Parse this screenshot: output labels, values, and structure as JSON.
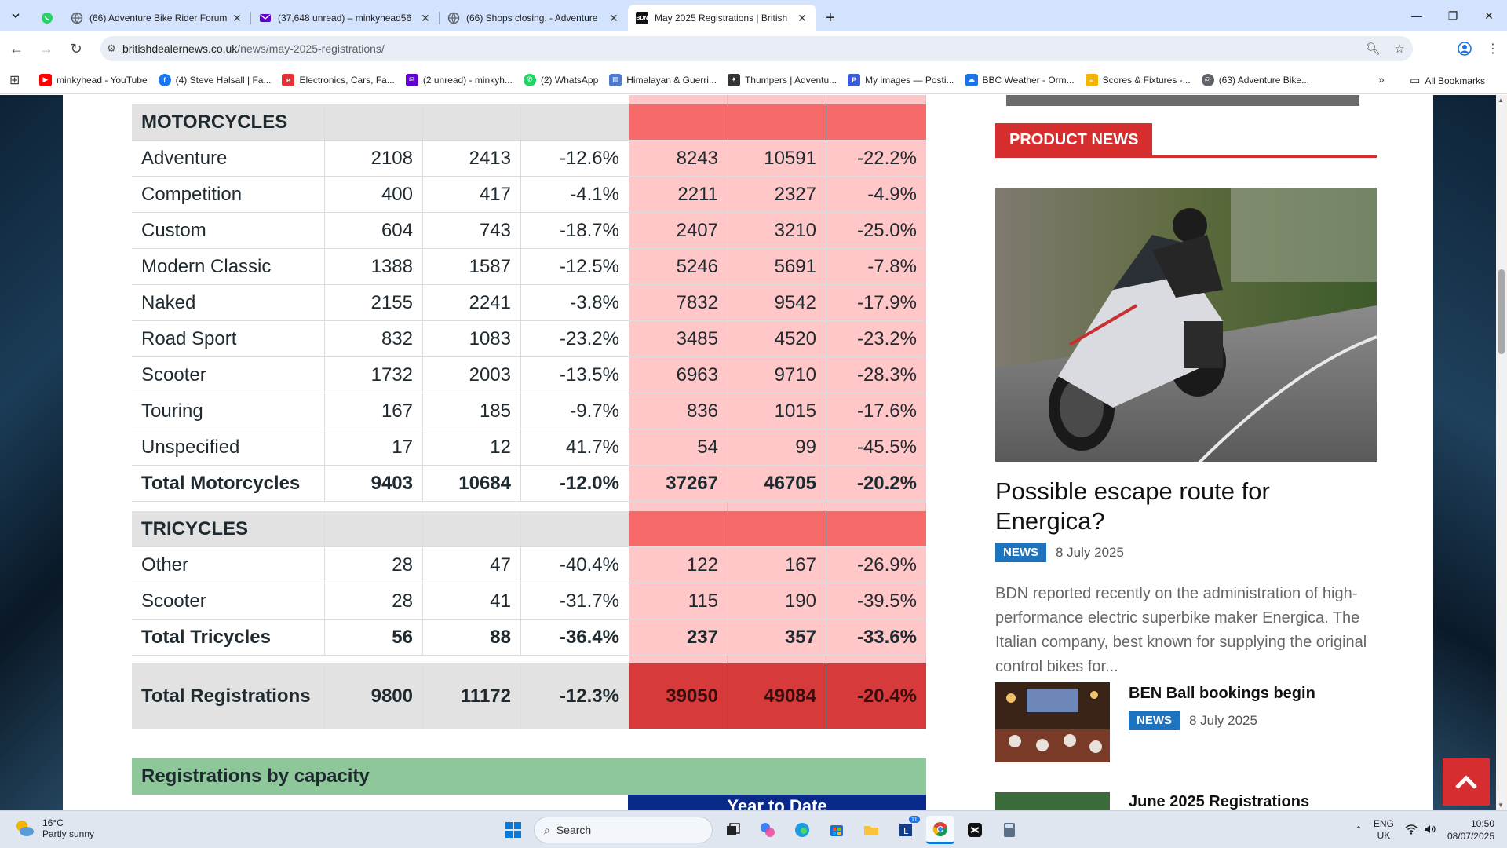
{
  "browser": {
    "tabs": [
      {
        "title": "(66) Adventure Bike Rider Forum",
        "favicon": "globe-icon",
        "active": false
      },
      {
        "title": "(37,648 unread) – minkyhead56",
        "favicon": "yahoo-mail-icon",
        "active": false
      },
      {
        "title": "(66) Shops closing. - Adventure",
        "favicon": "globe-icon",
        "active": false
      },
      {
        "title": "May 2025 Registrations | British",
        "favicon": "bdn-icon",
        "active": true
      }
    ],
    "favicon_bdn_text": "BDN",
    "new_tab_label": "+",
    "url_host": "britishdealernews.co.uk",
    "url_path": "/news/may-2025-registrations/",
    "bookmarks": [
      {
        "label": "minkyhead - YouTube",
        "icon": "youtube-icon",
        "color": "#ff0000"
      },
      {
        "label": "(4) Steve Halsall | Fa...",
        "icon": "facebook-icon",
        "color": "#1877f2"
      },
      {
        "label": "Electronics, Cars, Fa...",
        "icon": "ebay-icon",
        "color": "#e53238"
      },
      {
        "label": "(2 unread) - minkyh...",
        "icon": "yahoo-mail-icon",
        "color": "#6001d2"
      },
      {
        "label": "(2) WhatsApp",
        "icon": "whatsapp-icon",
        "color": "#25d366"
      },
      {
        "label": "Himalayan & Guerri...",
        "icon": "bookmark-page-icon",
        "color": "#4a7bd0"
      },
      {
        "label": "Thumpers | Adventu...",
        "icon": "thumpers-icon",
        "color": "#333333"
      },
      {
        "label": "My images — Posti...",
        "icon": "postimages-icon",
        "color": "#3a5bd9"
      },
      {
        "label": "BBC Weather - Orm...",
        "icon": "bbc-weather-icon",
        "color": "#1a73e8"
      },
      {
        "label": "Scores & Fixtures -...",
        "icon": "scores-icon",
        "color": "#f4b400"
      },
      {
        "label": "(63) Adventure Bike...",
        "icon": "globe-icon",
        "color": "#5f6368"
      }
    ],
    "all_bookmarks": "All Bookmarks"
  },
  "table": {
    "sections": [
      {
        "name": "MOTORCYCLES",
        "rows": [
          {
            "label": "Adventure",
            "v": [
              "2108",
              "2413",
              "-12.6%",
              "8243",
              "10591",
              "-22.2%"
            ]
          },
          {
            "label": "Competition",
            "v": [
              "400",
              "417",
              "-4.1%",
              "2211",
              "2327",
              "-4.9%"
            ]
          },
          {
            "label": "Custom",
            "v": [
              "604",
              "743",
              "-18.7%",
              "2407",
              "3210",
              "-25.0%"
            ]
          },
          {
            "label": "Modern Classic",
            "v": [
              "1388",
              "1587",
              "-12.5%",
              "5246",
              "5691",
              "-7.8%"
            ]
          },
          {
            "label": "Naked",
            "v": [
              "2155",
              "2241",
              "-3.8%",
              "7832",
              "9542",
              "-17.9%"
            ]
          },
          {
            "label": "Road Sport",
            "v": [
              "832",
              "1083",
              "-23.2%",
              "3485",
              "4520",
              "-23.2%"
            ]
          },
          {
            "label": "Scooter",
            "v": [
              "1732",
              "2003",
              "-13.5%",
              "6963",
              "9710",
              "-28.3%"
            ]
          },
          {
            "label": "Touring",
            "v": [
              "167",
              "185",
              "-9.7%",
              "836",
              "1015",
              "-17.6%"
            ]
          },
          {
            "label": "Unspecified",
            "v": [
              "17",
              "12",
              "41.7%",
              "54",
              "99",
              "-45.5%"
            ]
          }
        ],
        "total": {
          "label": "Total Motorcycles",
          "v": [
            "9403",
            "10684",
            "-12.0%",
            "37267",
            "46705",
            "-20.2%"
          ]
        }
      },
      {
        "name": "TRICYCLES",
        "rows": [
          {
            "label": "Other",
            "v": [
              "28",
              "47",
              "-40.4%",
              "122",
              "167",
              "-26.9%"
            ]
          },
          {
            "label": "Scooter",
            "v": [
              "28",
              "41",
              "-31.7%",
              "115",
              "190",
              "-39.5%"
            ]
          }
        ],
        "total": {
          "label": "Total Tricycles",
          "v": [
            "56",
            "88",
            "-36.4%",
            "237",
            "357",
            "-33.6%"
          ]
        }
      }
    ],
    "grand_total": {
      "label": "Total Registrations",
      "v": [
        "9800",
        "11172",
        "-12.3%",
        "39050",
        "49084",
        "-20.4%"
      ]
    },
    "capacity_heading": "Registrations by capacity",
    "ytd_heading": "Year to Date"
  },
  "sidebar": {
    "section_title": "PRODUCT NEWS",
    "featured": {
      "title": "Possible escape route for Energica?",
      "badge": "NEWS",
      "date": "8 July 2025",
      "excerpt": "BDN reported recently on the administration of high-performance electric superbike maker Energica. The Italian company, best known for supplying the original control bikes for..."
    },
    "items": [
      {
        "title": "BEN Ball bookings begin",
        "badge": "NEWS",
        "date": "8 July 2025"
      },
      {
        "title": "June 2025 Registrations"
      }
    ]
  },
  "taskbar": {
    "temperature": "16°C",
    "weather": "Partly sunny",
    "search_placeholder": "Search",
    "lang_line1": "ENG",
    "lang_line2": "UK",
    "time": "10:50",
    "date": "08/07/2025",
    "mail_badge": "11"
  },
  "colors": {
    "accent_red": "#d62e2e",
    "news_blue": "#1e73be",
    "ytd_light": "#ffc7c7",
    "ytd_header": "#f76a6a",
    "ytd_total": "#d63a3a",
    "capacity_green": "#8ec79a"
  }
}
